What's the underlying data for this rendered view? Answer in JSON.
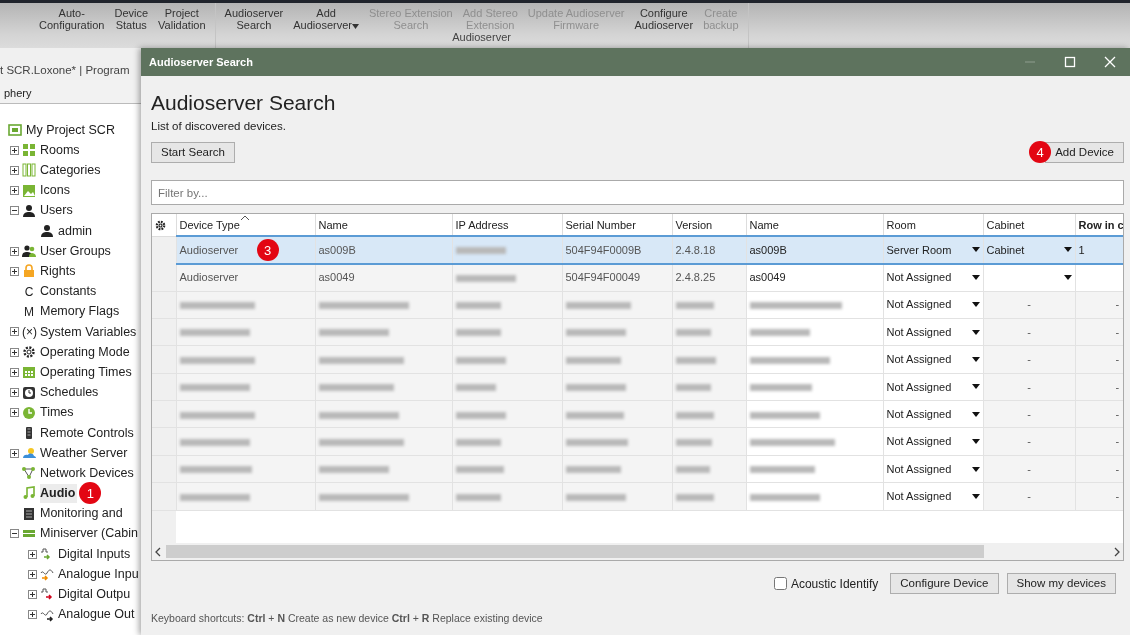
{
  "ribbon": {
    "groups": [
      {
        "buttons": [
          {
            "label": "Auto-\nConfiguration",
            "disabled": false,
            "menu": false
          },
          {
            "label": "Device\nStatus",
            "disabled": false,
            "menu": false
          },
          {
            "label": "Project\nValidation",
            "disabled": false,
            "menu": false
          }
        ]
      },
      {
        "label": "Audioserver",
        "buttons": [
          {
            "label": "Audioserver\nSearch",
            "disabled": false,
            "menu": false
          },
          {
            "label": "Add\nAudioserver",
            "disabled": false,
            "menu": true
          },
          {
            "label": "Stereo Extension\nSearch",
            "disabled": true,
            "menu": false
          },
          {
            "label": "Add Stereo\nExtension",
            "disabled": true,
            "menu": false
          },
          {
            "label": "Update Audioserver\nFirmware",
            "disabled": true,
            "menu": false
          },
          {
            "label": "Configure\nAudioserver",
            "disabled": false,
            "menu": false
          },
          {
            "label": "Create\nbackup",
            "disabled": true,
            "menu": false
          }
        ]
      }
    ]
  },
  "breadcrumb": "t SCR.Loxone*  |  Program",
  "panel_tab": "phery",
  "tree": {
    "label": "My Project SCR",
    "selected": false,
    "children": [
      {
        "label": "Rooms",
        "expanded": false,
        "selected": false
      },
      {
        "label": "Categories",
        "expanded": false,
        "selected": false
      },
      {
        "label": "Icons",
        "expanded": false,
        "selected": false
      },
      {
        "label": "Users",
        "expanded": true,
        "selected": false,
        "children": [
          {
            "label": "admin",
            "selected": false
          }
        ]
      },
      {
        "label": "User Groups",
        "expanded": false,
        "selected": false
      },
      {
        "label": "Rights",
        "expanded": false,
        "selected": false
      },
      {
        "label": "Constants",
        "glyph": "C",
        "selected": false
      },
      {
        "label": "Memory Flags",
        "glyph": "M",
        "selected": false
      },
      {
        "label": "System Variables",
        "glyph": "(×)",
        "expanded": false,
        "selected": false
      },
      {
        "label": "Operating Mode",
        "expanded": false,
        "selected": false
      },
      {
        "label": "Operating Times",
        "expanded": false,
        "selected": false
      },
      {
        "label": "Schedules",
        "expanded": false,
        "selected": false
      },
      {
        "label": "Times",
        "expanded": false,
        "selected": false
      },
      {
        "label": "Remote Controls",
        "selected": false
      },
      {
        "label": "Weather Server",
        "expanded": false,
        "selected": false
      },
      {
        "label": "Network Devices",
        "selected": false
      },
      {
        "label": "Audio",
        "selected": true,
        "callout": "1"
      },
      {
        "label": "Monitoring and",
        "selected": false
      },
      {
        "label": "Miniserver (Cabin",
        "expanded": true,
        "selected": false,
        "children": [
          {
            "label": "Digital Inputs",
            "expanded": false,
            "selected": false
          },
          {
            "label": "Analogue Inpu",
            "expanded": false,
            "selected": false
          },
          {
            "label": "Digital Outpu",
            "expanded": false,
            "selected": false
          },
          {
            "label": "Analogue Out",
            "expanded": false,
            "selected": false
          }
        ]
      }
    ]
  },
  "dialog": {
    "title": "Audioserver Search",
    "window_controls": [
      {
        "kind": "minimize",
        "disabled": true
      },
      {
        "kind": "maximize",
        "disabled": false
      },
      {
        "kind": "close",
        "disabled": false
      }
    ],
    "heading": "Audioserver Search",
    "subtitle": "List of discovered devices.",
    "start_search": "Start Search",
    "add_device": {
      "label": "Add Device",
      "callout": "4"
    },
    "filter_placeholder": "Filter by...",
    "columns": [
      {
        "label": "Device Type",
        "sorted": true,
        "emphasized": false
      },
      {
        "label": "Name",
        "sorted": false,
        "emphasized": false
      },
      {
        "label": "IP Address",
        "sorted": false,
        "emphasized": false
      },
      {
        "label": "Serial Number",
        "sorted": false,
        "emphasized": false
      },
      {
        "label": "Version",
        "sorted": false,
        "emphasized": false
      },
      {
        "label": "Name",
        "sorted": false,
        "emphasized": false
      },
      {
        "label": "Room",
        "sorted": false,
        "emphasized": false
      },
      {
        "label": "Cabinet",
        "sorted": false,
        "emphasized": false
      },
      {
        "label": "Row in c",
        "sorted": false,
        "emphasized": true
      }
    ],
    "rows": [
      {
        "selected": true,
        "editable": true,
        "callout": "3",
        "device_type": "Audioserver",
        "name": "as009B",
        "serial_number": "504F94F0009B",
        "version": "2.4.8.18",
        "name_2": "as009B",
        "room": "Server Room",
        "cabinet": "Cabinet",
        "row_in": "1"
      },
      {
        "selected": false,
        "editable": true,
        "device_type": "Audioserver",
        "name": "as0049",
        "serial_number": "504F94F00049",
        "version": "2.4.8.25",
        "name_2": "as0049",
        "room": "Not Assigned"
      },
      {
        "selected": false,
        "editable": false,
        "room": "Not Assigned",
        "cabinet": "-",
        "row_in": "-"
      },
      {
        "selected": false,
        "editable": false,
        "room": "Not Assigned",
        "cabinet": "-",
        "row_in": "-"
      },
      {
        "selected": false,
        "editable": false,
        "room": "Not Assigned",
        "cabinet": "-",
        "row_in": "-"
      },
      {
        "selected": false,
        "editable": false,
        "room": "Not Assigned",
        "cabinet": "-",
        "row_in": "-"
      },
      {
        "selected": false,
        "editable": false,
        "room": "Not Assigned",
        "cabinet": "-",
        "row_in": "-"
      },
      {
        "selected": false,
        "editable": false,
        "room": "Not Assigned",
        "cabinet": "-",
        "row_in": "-"
      },
      {
        "selected": false,
        "editable": false,
        "room": "Not Assigned",
        "cabinet": "-",
        "row_in": "-"
      },
      {
        "selected": false,
        "editable": false,
        "room": "Not Assigned",
        "cabinet": "-",
        "row_in": "-"
      }
    ],
    "acoustic_identify": {
      "label": "Acoustic Identify",
      "checked": false
    },
    "buttons": [
      "Configure Device",
      "Show my devices"
    ],
    "shortcuts": "Keyboard shortcuts: **Ctrl** + **N** Create as new device **Ctrl** + **R** Replace existing device"
  }
}
